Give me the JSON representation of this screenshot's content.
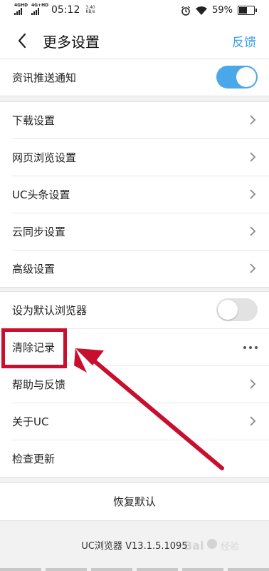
{
  "status_bar": {
    "signal1_label": "4GHD",
    "signal2_label": "4G+HD",
    "time": "05:12",
    "speed_value": "3.40",
    "speed_unit": "KB/s",
    "battery_percent": "59%",
    "battery_level": 0.59
  },
  "header": {
    "title": "更多设置",
    "feedback_label": "反馈"
  },
  "group_news": {
    "push_label": "资讯推送通知",
    "push_on": true
  },
  "group_settings": {
    "items": [
      {
        "label": "下载设置"
      },
      {
        "label": "网页浏览设置"
      },
      {
        "label": "UC头条设置"
      },
      {
        "label": "云同步设置"
      },
      {
        "label": "高级设置"
      }
    ]
  },
  "group_misc": {
    "default_browser_label": "设为默认浏览器",
    "default_browser_on": false,
    "clear_records_label": "清除记录",
    "help_label": "帮助与反馈",
    "about_label": "关于UC",
    "check_update_label": "检查更新"
  },
  "reset_label": "恢复默认",
  "version_text": "UC浏览器 V13.1.5.1095",
  "watermark_text": "Bai 经验",
  "colors": {
    "accent": "#3aa0e5",
    "toggle_on": "#4aa8e8",
    "annotation": "#c8102e"
  }
}
